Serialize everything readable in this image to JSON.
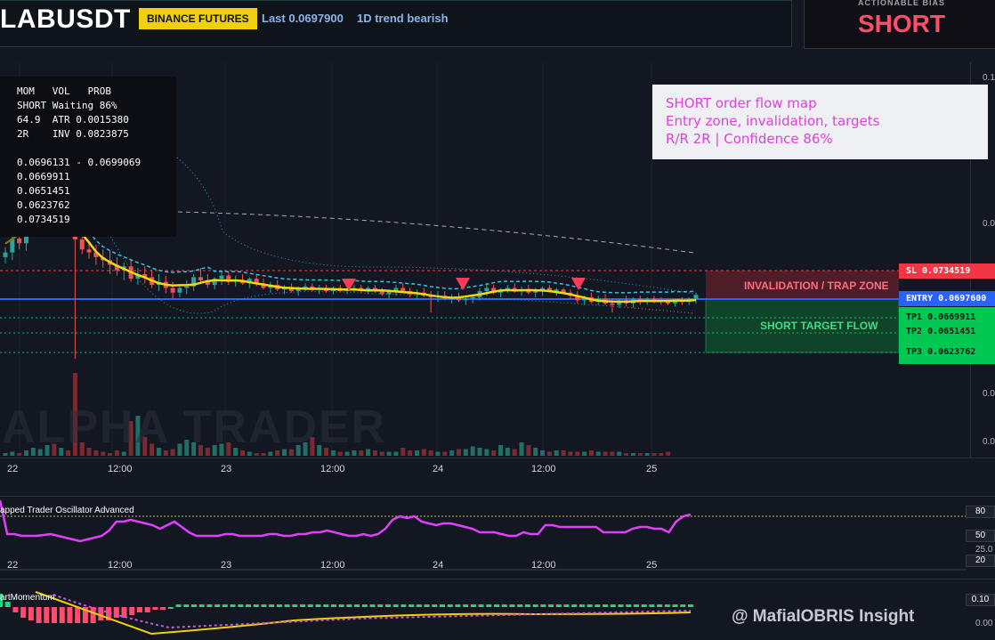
{
  "header": {
    "symbol": "LABUSDT",
    "exchange": "BINANCE FUTURES",
    "last": "Last 0.0697900",
    "trend": "1D trend bearish"
  },
  "bias": {
    "label": "ACTIONABLE BIAS",
    "value": "SHORT"
  },
  "info_panel": {
    "lines": [
      "MOM   VOL   PROB",
      "SHORT Waiting 86%",
      "64.9  ATR 0.0015380",
      "2R    INV 0.0823875",
      "",
      "0.0696131 - 0.0699069",
      "0.0669911",
      "0.0651451",
      "0.0623762",
      "0.0734519"
    ]
  },
  "note": {
    "line1": "SHORT order flow map",
    "line2": "Entry zone, invalidation, targets",
    "line3": "R/R 2R | Confidence 86%"
  },
  "zones": {
    "invalidation": "INVALIDATION / TRAP ZONE",
    "target": "SHORT TARGET FLOW"
  },
  "price_tags": {
    "sl": "SL 0.0734519",
    "entry": "ENTRY 0.0697600",
    "tp1": "TP1 0.0669911",
    "tp2": "TP2 0.0651451",
    "tp3": "TP3 0.0623762"
  },
  "watermark": "ALPHA TRADER",
  "oscillator": {
    "title": "apped Trader Oscillator Advanced",
    "levels": [
      "80",
      "50",
      "25.0",
      "20"
    ]
  },
  "momentum": {
    "title": "artMomentum",
    "levels": [
      "0.10",
      "0.00"
    ]
  },
  "credit": "@ MafiaIOBRIS Insight",
  "colors": {
    "bull": "#26a69a",
    "bear": "#ef5350",
    "accent_yellow": "#f0d00a",
    "bias_red": "#ff4d6b",
    "entry_blue": "#2962ff",
    "osc_line": "#e040fb"
  },
  "chart_data": {
    "type": "candlestick",
    "title": "LABUSDT",
    "x_ticks": [
      "22",
      "12:00",
      "23",
      "12:00",
      "24",
      "12:00",
      "25"
    ],
    "y_ticks_visible": [
      "0.1",
      "0.0",
      "0.0",
      "0.0"
    ],
    "levels": {
      "stop_loss": 0.0734519,
      "entry": 0.06976,
      "tp1": 0.0669911,
      "tp2": 0.0651451,
      "tp3": 0.0623762
    },
    "ylim": [
      0.058,
      0.1
    ],
    "candles_ohlc": [
      [
        0.0752,
        0.0765,
        0.0744,
        0.0758
      ],
      [
        0.0758,
        0.0782,
        0.0748,
        0.0776
      ],
      [
        0.0776,
        0.0791,
        0.0762,
        0.077
      ],
      [
        0.077,
        0.08,
        0.076,
        0.0796
      ],
      [
        0.0796,
        0.0812,
        0.0785,
        0.0803
      ],
      [
        0.0803,
        0.083,
        0.0795,
        0.082
      ],
      [
        0.082,
        0.0852,
        0.081,
        0.0838
      ],
      [
        0.0838,
        0.086,
        0.0805,
        0.0815
      ],
      [
        0.0815,
        0.0836,
        0.08,
        0.0825
      ],
      [
        0.0825,
        0.0838,
        0.08,
        0.0818
      ],
      [
        0.0818,
        0.0826,
        0.062,
        0.0775
      ],
      [
        0.0775,
        0.0785,
        0.0756,
        0.0762
      ],
      [
        0.0762,
        0.0772,
        0.075,
        0.0758
      ],
      [
        0.0758,
        0.0768,
        0.0742,
        0.0752
      ],
      [
        0.0752,
        0.0762,
        0.0738,
        0.0748
      ],
      [
        0.0748,
        0.076,
        0.073,
        0.0742
      ],
      [
        0.0742,
        0.0752,
        0.0728,
        0.0735
      ],
      [
        0.0735,
        0.0745,
        0.0722,
        0.074
      ],
      [
        0.074,
        0.075,
        0.072,
        0.0724
      ],
      [
        0.0724,
        0.0738,
        0.0716,
        0.073
      ],
      [
        0.073,
        0.074,
        0.0718,
        0.0726
      ],
      [
        0.0726,
        0.0736,
        0.0712,
        0.0716
      ],
      [
        0.0716,
        0.073,
        0.0708,
        0.072
      ],
      [
        0.072,
        0.0728,
        0.0705,
        0.0712
      ],
      [
        0.0712,
        0.072,
        0.0698,
        0.0706
      ],
      [
        0.0706,
        0.0716,
        0.07,
        0.0712
      ],
      [
        0.0712,
        0.0722,
        0.0704,
        0.0714
      ],
      [
        0.0714,
        0.073,
        0.0708,
        0.0726
      ],
      [
        0.0726,
        0.0738,
        0.0718,
        0.0722
      ],
      [
        0.0722,
        0.073,
        0.0712,
        0.0716
      ],
      [
        0.0716,
        0.0726,
        0.071,
        0.0724
      ],
      [
        0.0724,
        0.0734,
        0.0716,
        0.0728
      ],
      [
        0.0728,
        0.0732,
        0.0716,
        0.072
      ],
      [
        0.072,
        0.0728,
        0.0714,
        0.0722
      ],
      [
        0.0722,
        0.073,
        0.0716,
        0.0718
      ],
      [
        0.0718,
        0.0726,
        0.0712,
        0.0724
      ],
      [
        0.0724,
        0.073,
        0.0714,
        0.0718
      ],
      [
        0.0718,
        0.0724,
        0.071,
        0.0712
      ],
      [
        0.0712,
        0.072,
        0.0706,
        0.0716
      ],
      [
        0.0716,
        0.0722,
        0.0708,
        0.071
      ],
      [
        0.071,
        0.0716,
        0.0704,
        0.0712
      ],
      [
        0.0712,
        0.0718,
        0.0706,
        0.0708
      ],
      [
        0.0708,
        0.0714,
        0.0702,
        0.0712
      ],
      [
        0.0712,
        0.0718,
        0.0708,
        0.0714
      ],
      [
        0.0714,
        0.0718,
        0.0708,
        0.071
      ],
      [
        0.071,
        0.0716,
        0.0704,
        0.0712
      ],
      [
        0.0712,
        0.0716,
        0.0706,
        0.0708
      ],
      [
        0.0708,
        0.0714,
        0.0704,
        0.0712
      ],
      [
        0.0712,
        0.0716,
        0.0706,
        0.0708
      ],
      [
        0.0708,
        0.0714,
        0.0704,
        0.071
      ],
      [
        0.071,
        0.0716,
        0.0706,
        0.0712
      ],
      [
        0.0712,
        0.0716,
        0.0706,
        0.0708
      ],
      [
        0.0708,
        0.0714,
        0.0704,
        0.0712
      ],
      [
        0.0712,
        0.0716,
        0.0706,
        0.0708
      ],
      [
        0.0708,
        0.0712,
        0.0702,
        0.0704
      ],
      [
        0.0704,
        0.071,
        0.0698,
        0.0708
      ],
      [
        0.0708,
        0.0716,
        0.0702,
        0.0712
      ],
      [
        0.0712,
        0.0718,
        0.0706,
        0.0708
      ],
      [
        0.0708,
        0.0712,
        0.07,
        0.0704
      ],
      [
        0.0704,
        0.071,
        0.0698,
        0.0706
      ],
      [
        0.0706,
        0.0712,
        0.07,
        0.0702
      ],
      [
        0.0702,
        0.0708,
        0.068,
        0.07
      ],
      [
        0.07,
        0.0708,
        0.0694,
        0.0702
      ],
      [
        0.0702,
        0.0708,
        0.0696,
        0.0698
      ],
      [
        0.0698,
        0.0704,
        0.0692,
        0.07
      ],
      [
        0.07,
        0.0706,
        0.0694,
        0.0696
      ],
      [
        0.0696,
        0.0702,
        0.069,
        0.0698
      ],
      [
        0.0698,
        0.0704,
        0.0692,
        0.07
      ],
      [
        0.07,
        0.0712,
        0.0696,
        0.0708
      ],
      [
        0.0708,
        0.0716,
        0.0702,
        0.0712
      ],
      [
        0.0712,
        0.0716,
        0.0704,
        0.0706
      ],
      [
        0.0706,
        0.0712,
        0.07,
        0.071
      ],
      [
        0.071,
        0.0716,
        0.0706,
        0.0712
      ],
      [
        0.0712,
        0.0718,
        0.0706,
        0.0708
      ],
      [
        0.0708,
        0.0714,
        0.0702,
        0.071
      ],
      [
        0.071,
        0.0716,
        0.0704,
        0.0706
      ],
      [
        0.0706,
        0.0712,
        0.07,
        0.0708
      ],
      [
        0.0708,
        0.0714,
        0.0702,
        0.0712
      ],
      [
        0.0712,
        0.0716,
        0.0706,
        0.0708
      ],
      [
        0.0708,
        0.0712,
        0.0702,
        0.071
      ],
      [
        0.071,
        0.0712,
        0.0704,
        0.0706
      ],
      [
        0.0706,
        0.071,
        0.0698,
        0.0702
      ],
      [
        0.0702,
        0.0708,
        0.0692,
        0.0696
      ],
      [
        0.0696,
        0.0702,
        0.069,
        0.07
      ],
      [
        0.07,
        0.0706,
        0.0692,
        0.0694
      ],
      [
        0.0694,
        0.0702,
        0.069,
        0.0698
      ],
      [
        0.0698,
        0.0704,
        0.069,
        0.0692
      ],
      [
        0.0692,
        0.0698,
        0.068,
        0.069
      ],
      [
        0.069,
        0.0698,
        0.0686,
        0.0696
      ],
      [
        0.0696,
        0.0702,
        0.0688,
        0.0692
      ],
      [
        0.0692,
        0.07,
        0.0686,
        0.0698
      ],
      [
        0.0698,
        0.0702,
        0.069,
        0.0694
      ],
      [
        0.0694,
        0.07,
        0.069,
        0.0698
      ],
      [
        0.0698,
        0.0702,
        0.0692,
        0.0696
      ],
      [
        0.0696,
        0.07,
        0.069,
        0.0694
      ],
      [
        0.0694,
        0.0698,
        0.069,
        0.0692
      ],
      [
        0.0692,
        0.0698,
        0.0688,
        0.0696
      ],
      [
        0.0696,
        0.07,
        0.069,
        0.0694
      ],
      [
        0.0694,
        0.07,
        0.069,
        0.0698
      ],
      [
        0.0698,
        0.0706,
        0.0692,
        0.0703
      ]
    ],
    "oscillator_values": [
      98,
      60,
      60,
      58,
      58,
      58,
      59,
      60,
      58,
      56,
      54,
      52,
      54,
      56,
      58,
      64,
      74,
      74,
      76,
      74,
      72,
      70,
      66,
      70,
      74,
      68,
      62,
      58,
      58,
      58,
      58,
      60,
      60,
      58,
      58,
      58,
      58,
      60,
      60,
      58,
      58,
      60,
      60,
      62,
      62,
      64,
      62,
      60,
      58,
      58,
      60,
      58,
      60,
      66,
      76,
      80,
      78,
      80,
      74,
      72,
      70,
      72,
      72,
      70,
      68,
      66,
      62,
      62,
      62,
      60,
      58,
      58,
      62,
      60,
      60,
      70,
      70,
      68,
      68,
      68,
      68,
      68,
      68,
      62,
      62,
      62,
      62,
      66,
      68,
      68,
      66,
      66,
      62,
      74,
      80,
      82
    ],
    "momentum_values": [
      0.05,
      0.02,
      -0.02,
      -0.04,
      -0.05,
      -0.06,
      -0.06,
      -0.06,
      -0.06,
      -0.06,
      -0.06,
      -0.06,
      -0.06,
      -0.05,
      -0.05,
      -0.04,
      -0.04,
      -0.03,
      -0.02,
      -0.02,
      -0.01,
      -0.01,
      0.0,
      0.01,
      0.01,
      0.01,
      0.01,
      0.01,
      0.01,
      0.01,
      0.01,
      0.01,
      0.01,
      0.01,
      0.01,
      0.01,
      0.01,
      0.01,
      0.01,
      0.01,
      0.01,
      0.01,
      0.01,
      0.01,
      0.01,
      0.01,
      0.01,
      0.01,
      0.01,
      0.01,
      0.01,
      0.01,
      0.01,
      0.01,
      0.01,
      0.01,
      0.01,
      0.01,
      0.01,
      0.01,
      0.01,
      0.01,
      0.01,
      0.01,
      0.01,
      0.01,
      0.01,
      0.01,
      0.01,
      0.01,
      0.01,
      0.01,
      0.01,
      0.01,
      0.01,
      0.01,
      0.01,
      0.01,
      0.01,
      0.01,
      0.01,
      0.01,
      0.01,
      0.01,
      0.01,
      0.01,
      0.01,
      0.01,
      0.01,
      0.01
    ]
  }
}
